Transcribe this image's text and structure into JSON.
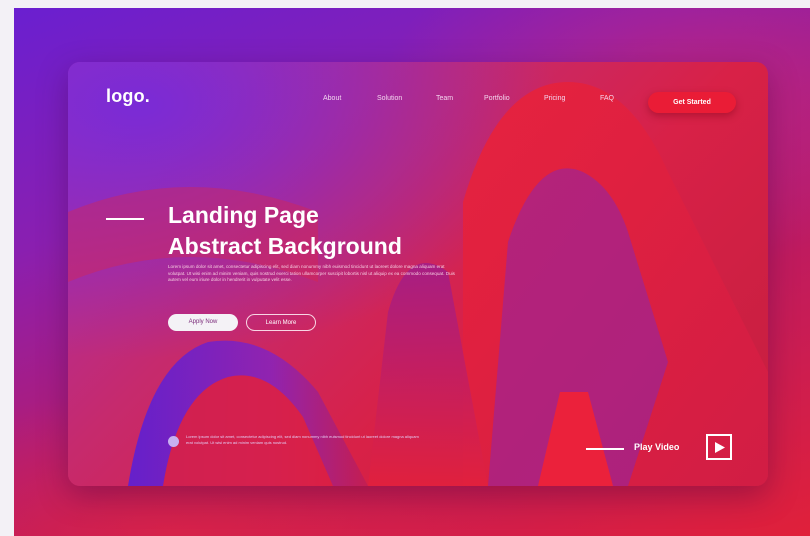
{
  "brand": {
    "logo": "logo."
  },
  "nav": {
    "items": [
      {
        "label": "About"
      },
      {
        "label": "Solution"
      },
      {
        "label": "Team"
      },
      {
        "label": "Portfolio"
      },
      {
        "label": "Pricing"
      },
      {
        "label": "FAQ"
      }
    ],
    "cta_label": "Get Started"
  },
  "hero": {
    "title_line1": "Landing Page",
    "title_line2": "Abstract Background",
    "body": "Lorem ipsum dolor sit amet, consectetur adipiscing elit, sed diam nonummy nibh euismod tincidunt ut laoreet dolore magna aliquam erat volutpat. Ut wisi enim ad minim veniam, quis nostrud exerci tation ullamcorper suscipit lobortis nisl ut aliquip ex ea commodo consequat. Duis autem vel eum iriure dolor in hendrerit in vulputate velit esse.",
    "apply_label": "Apply Now",
    "learn_label": "Learn More"
  },
  "footer": {
    "text": "Lorem ipsum dolor sit amet, consectetur adipiscing elit, sed diam nonummy nibh euismod tincidunt ut laoreet dolore magna aliquam erat volutpat. Ut wisi enim ad minim veniam quis nostrud.",
    "play_label": "Play Video"
  },
  "colors": {
    "cta": "#ea1c36",
    "purple": "#6a1fd0",
    "red": "#e0203a"
  },
  "icons": {
    "play": "play-icon",
    "bullet": "dot-icon"
  }
}
